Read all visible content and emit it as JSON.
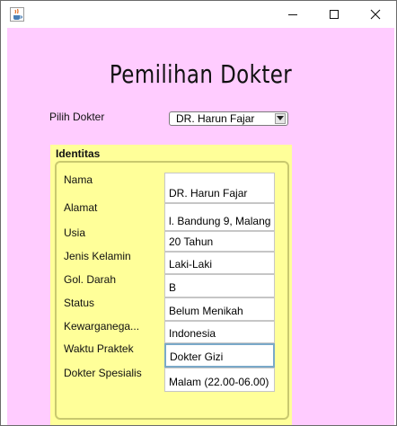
{
  "window": {
    "title": "",
    "icon": "java-cup-icon",
    "controls": {
      "minimize": "minimize-icon",
      "maximize": "maximize-icon",
      "close": "close-icon"
    }
  },
  "colors": {
    "background": "#ffccff",
    "panel": "#ffff99",
    "panel_border": "#c9c96e",
    "focus": "#7aa9c9"
  },
  "header": {
    "title": "Pemilihan Dokter"
  },
  "selector": {
    "label": "Pilih Dokter",
    "selected": "DR. Harun Fajar"
  },
  "identitas": {
    "title": "Identitas",
    "labels": {
      "nama": "Nama",
      "alamat": "Alamat",
      "usia": "Usia",
      "jenis_kelamin": "Jenis Kelamin",
      "gol_darah": "Gol. Darah",
      "status": "Status",
      "kewarganegaraan": "Kewarganega...",
      "waktu_praktek": "Waktu Praktek",
      "dokter_spesialis": "Dokter Spesialis"
    },
    "values": {
      "nama": "DR. Harun Fajar",
      "alamat": "l. Bandung 9, Malang",
      "usia": "20 Tahun",
      "jenis_kelamin": "Laki-Laki",
      "gol_darah": "B",
      "status": "Belum Menikah",
      "kewarganegaraan": "Indonesia",
      "spesialis_field": "Dokter Gizi",
      "waktu_field": "Malam (22.00-06.00)"
    }
  }
}
